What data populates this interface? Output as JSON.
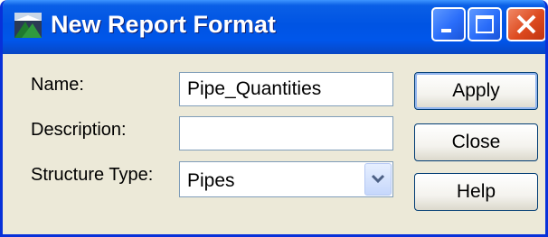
{
  "window": {
    "title": "New Report Format",
    "controls": {
      "minimize_icon": "minimize-icon",
      "maximize_icon": "maximize-icon",
      "close_icon": "close-icon"
    }
  },
  "form": {
    "name_label": "Name:",
    "name_value": "Pipe_Quantities",
    "description_label": "Description:",
    "description_value": "",
    "structure_type_label": "Structure Type:",
    "structure_type_value": "Pipes"
  },
  "buttons": {
    "apply": "Apply",
    "close": "Close",
    "help": "Help"
  },
  "colors": {
    "titlebar": "#0054e3",
    "dialog_bg": "#ece9d8",
    "close_button": "#dd4a1f"
  }
}
